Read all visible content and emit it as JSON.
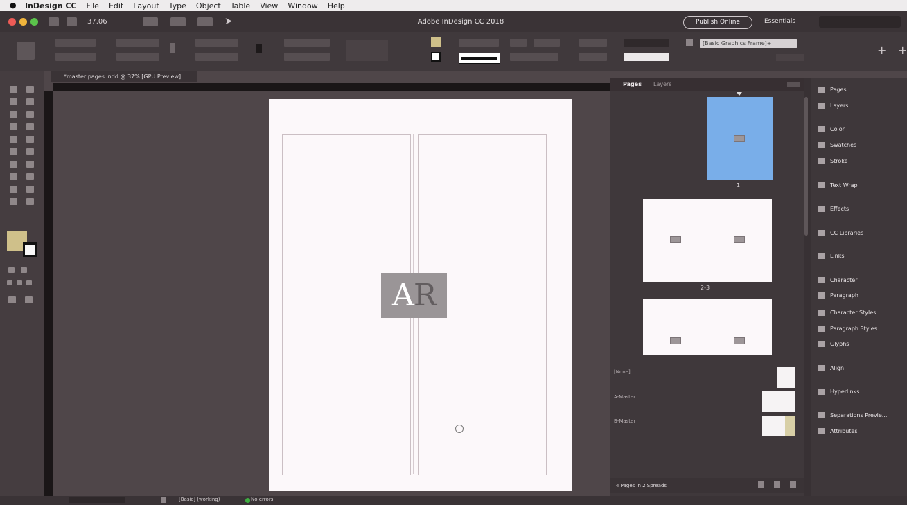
{
  "menubar": {
    "app_name": "InDesign CC",
    "items": [
      "File",
      "Edit",
      "Layout",
      "Type",
      "Object",
      "Table",
      "View",
      "Window",
      "Help"
    ]
  },
  "appbar": {
    "zoom": "37.06",
    "title": "Adobe InDesign CC 2018",
    "publish_label": "Publish Online",
    "workspace": "Essentials"
  },
  "control": {
    "style_dropdown": "[Basic Graphics Frame]+"
  },
  "document": {
    "tab_title": "*master pages.indd @ 37% [GPU Preview]",
    "master_label": "AR"
  },
  "pages_panel": {
    "tabs": {
      "pages": "Pages",
      "layers": "Layers"
    },
    "page_number": "1",
    "spread_label": "2-3",
    "labels": {
      "none": "[None]",
      "a_master": "A-Master",
      "b_master": "B-Master"
    },
    "footer": "4 Pages in 2 Spreads"
  },
  "dock": {
    "items": [
      {
        "icon": "pages-icon",
        "label": "Pages"
      },
      {
        "icon": "layers-icon",
        "label": "Layers"
      },
      {
        "icon": "color-icon",
        "label": "Color"
      },
      {
        "icon": "swatches-icon",
        "label": "Swatches"
      },
      {
        "icon": "stroke-icon",
        "label": "Stroke"
      },
      {
        "icon": "text-wrap-icon",
        "label": "Text Wrap"
      },
      {
        "icon": "effects-icon",
        "label": "Effects"
      },
      {
        "icon": "cc-libraries-icon",
        "label": "CC Libraries"
      },
      {
        "icon": "links-icon",
        "label": "Links"
      },
      {
        "icon": "character-icon",
        "label": "Character"
      },
      {
        "icon": "paragraph-icon",
        "label": "Paragraph"
      },
      {
        "icon": "character-styles-icon",
        "label": "Character Styles"
      },
      {
        "icon": "paragraph-styles-icon",
        "label": "Paragraph Styles"
      },
      {
        "icon": "glyphs-icon",
        "label": "Glyphs"
      },
      {
        "icon": "align-icon",
        "label": "Align"
      },
      {
        "icon": "hyperlinks-icon",
        "label": "Hyperlinks"
      },
      {
        "icon": "separations-preview-icon",
        "label": "Separations Previe..."
      },
      {
        "icon": "attributes-icon",
        "label": "Attributes"
      }
    ]
  },
  "status": {
    "page_style": "[Basic] (working)",
    "errors": "No errors"
  },
  "colors": {
    "fill": "#cfc08a",
    "selected_page": "#79aee9",
    "no_errors": "#3fae41"
  }
}
